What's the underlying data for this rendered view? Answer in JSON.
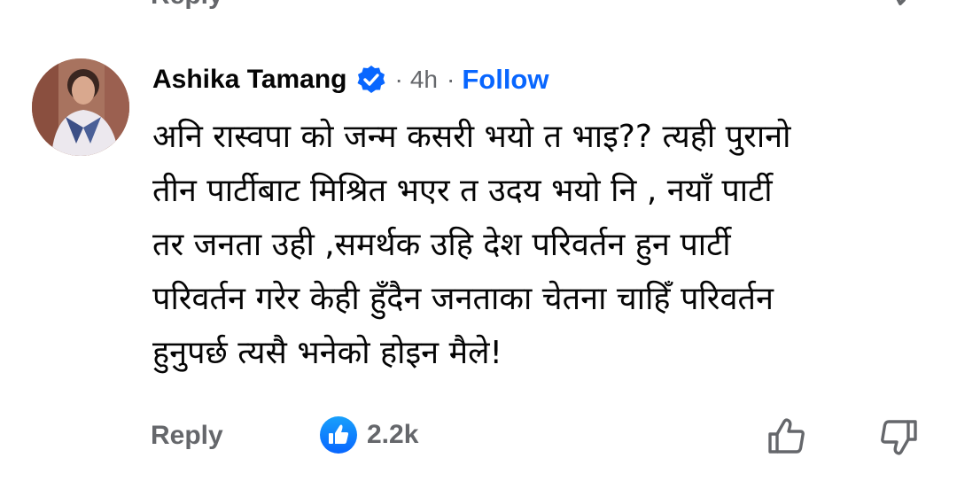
{
  "previous_comment": {
    "reply_label": "Reply"
  },
  "comment": {
    "author": "Ashika Tamang",
    "verified": true,
    "separator": "·",
    "time": "4h",
    "follow_label": "Follow",
    "body_lines": [
      "अनि रास्वपा को जन्म कसरी भयो त भाइ?? त्यही पुरानो",
      "तीन पार्टीबाट मिश्रित भएर त उदय भयो नि , नयाँ पार्टी",
      "तर जनता उही ,समर्थक उहि देश परिवर्तन हुन पार्टी",
      "परिवर्तन गरेर केही हुँदैन जनताका चेतना चाहिँ परिवर्तन",
      "हुनुपर्छ त्यसै भनेको होइन मैले!"
    ],
    "actions": {
      "reply_label": "Reply",
      "reaction_icon": "like-icon",
      "reaction_count": "2.2k",
      "upvote_icon": "thumbs-up-outline-icon",
      "downvote_icon": "thumbs-down-outline-icon"
    }
  },
  "colors": {
    "link_blue": "#0866ff",
    "secondary_text": "#65676b",
    "primary_text": "#050505"
  }
}
